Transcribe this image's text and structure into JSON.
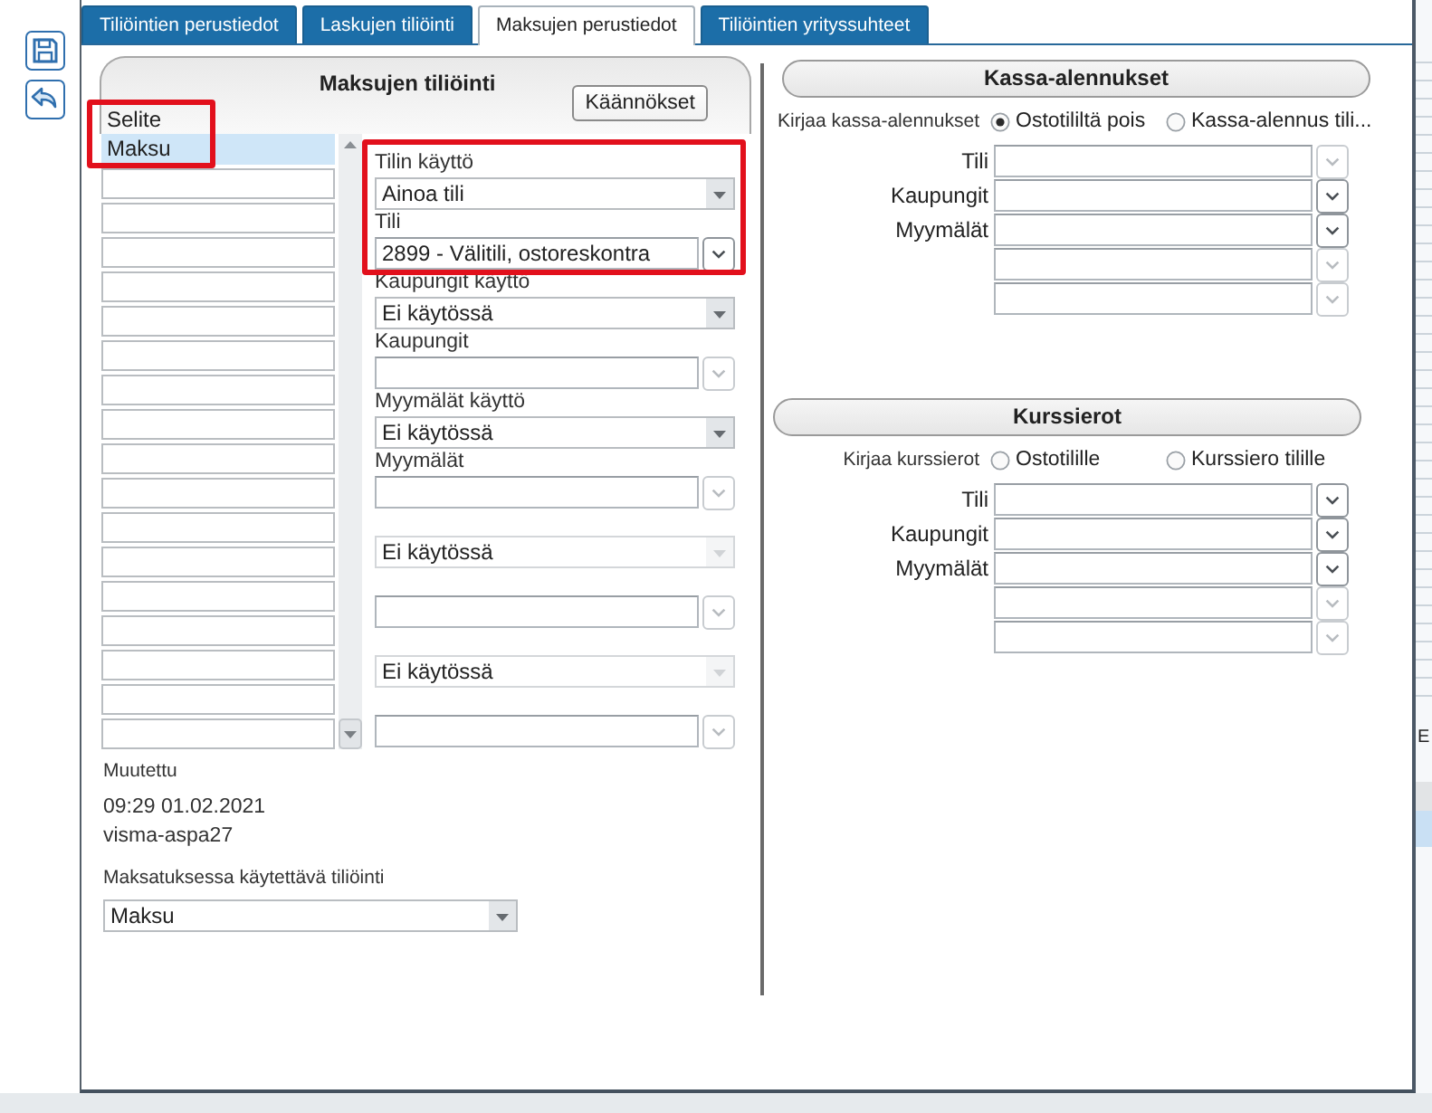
{
  "toolbar": [
    {
      "kind": "save"
    },
    {
      "kind": "undo"
    }
  ],
  "tabs": [
    {
      "label": "Tiliöintien perustiedot",
      "selected": false
    },
    {
      "label": "Laskujen tiliöinti",
      "selected": false
    },
    {
      "label": "Maksujen perustiedot",
      "selected": true
    },
    {
      "label": "Tiliöintien yrityssuhteet",
      "selected": false
    }
  ],
  "payment_posting": {
    "title": "Maksujen tiliöinti",
    "translations_button": "Käännökset",
    "list_label": "Selite",
    "list_highlighted": true,
    "rows": [
      {
        "text": "Maksu",
        "selected": true
      },
      {
        "selected": false
      },
      {
        "selected": false
      },
      {
        "selected": false
      },
      {
        "selected": false
      },
      {
        "selected": false
      },
      {
        "selected": false
      },
      {
        "selected": false
      },
      {
        "selected": false
      },
      {
        "selected": false
      },
      {
        "selected": false
      },
      {
        "selected": false
      },
      {
        "selected": false
      },
      {
        "selected": false
      },
      {
        "selected": false
      },
      {
        "selected": false
      },
      {
        "selected": false
      },
      {
        "selected": false
      }
    ],
    "fields": [
      {
        "kind": "select",
        "label": "Tilin käyttö",
        "value": "Ainoa tili",
        "disabled": false,
        "highlighted": true
      },
      {
        "kind": "combo",
        "label": "Tili",
        "value": "2899 - Välitili, ostoreskontra",
        "disabled": false,
        "highlighted": true
      },
      {
        "kind": "select",
        "label": "Kaupungit käyttö",
        "value": "Ei käytössä",
        "disabled": false,
        "highlighted": false
      },
      {
        "kind": "combo",
        "label": "Kaupungit",
        "disabled": true,
        "highlighted": false
      },
      {
        "kind": "select",
        "label": "Myymälät käyttö",
        "value": "Ei käytössä",
        "disabled": false,
        "highlighted": false
      },
      {
        "kind": "combo",
        "label": "Myymälät",
        "disabled": true,
        "highlighted": false
      },
      {
        "kind": "select",
        "value": "Ei käytössä",
        "disabled": true,
        "highlighted": false
      },
      {
        "kind": "combo",
        "disabled": true,
        "highlighted": false
      },
      {
        "kind": "select",
        "value": "Ei käytössä",
        "disabled": true,
        "highlighted": false
      },
      {
        "kind": "combo",
        "disabled": true,
        "highlighted": false
      }
    ],
    "modified_label": "Muutettu",
    "modified_time": "09:29 01.02.2021",
    "modified_by": "visma-aspa27",
    "posting_label": "Maksatuksessa käytettävä tiliöinti",
    "posting_value": "Maksu"
  },
  "cash_discounts": {
    "title": "Kassa-alennukset",
    "label": "Kirjaa kassa-alennukset",
    "options": [
      {
        "label": "Ostotililtä pois",
        "selected": true
      },
      {
        "label": "Kassa-alennus tili...",
        "selected": false
      }
    ],
    "rows": [
      {
        "label": "Tili",
        "disabled": true
      },
      {
        "label": "Kaupungit",
        "disabled": false
      },
      {
        "label": "Myymälät",
        "disabled": false
      },
      {
        "disabled": true
      },
      {
        "disabled": true
      }
    ]
  },
  "exchange_differences": {
    "title": "Kurssierot",
    "label": "Kirjaa kurssierot",
    "options": [
      {
        "label": "Ostotilille",
        "selected": false
      },
      {
        "label": "Kurssiero tilille",
        "selected": false
      }
    ],
    "rows": [
      {
        "label": "Tili",
        "disabled": false
      },
      {
        "label": "Kaupungit",
        "disabled": false
      },
      {
        "label": "Myymälät",
        "disabled": false
      },
      {
        "disabled": true
      },
      {
        "disabled": true
      }
    ]
  },
  "background_window": {
    "text": "E"
  }
}
